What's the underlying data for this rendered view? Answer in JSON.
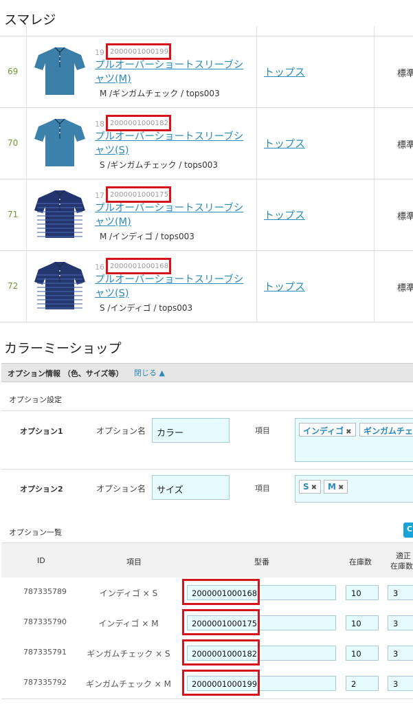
{
  "smaregi": {
    "title": "スマレジ",
    "rows": [
      {
        "num": "69",
        "rank": "19",
        "code": "2000001000199",
        "name": "プルオーバーショートスリーブシャツ(M)",
        "variant": "M  /ギンガムチェック  / tops003",
        "category": "トップス",
        "std": "標準",
        "shirt_color": "#3b7ea8",
        "stripe": false
      },
      {
        "num": "70",
        "rank": "18",
        "code": "2000001000182",
        "name": "プルオーバーショートスリーブシャツ(S)",
        "variant": "S  /ギンガムチェック  / tops003",
        "category": "トップス",
        "std": "標準",
        "shirt_color": "#3d82ad",
        "stripe": false
      },
      {
        "num": "71",
        "rank": "17",
        "code": "2000001000175",
        "name": "プルオーバーショートスリーブシャツ(M)",
        "variant": "M  /インディゴ  / tops003",
        "category": "トップス",
        "std": "標準",
        "shirt_color": "#23346e",
        "stripe": true
      },
      {
        "num": "72",
        "rank": "16",
        "code": "2000001000168",
        "name": "プルオーバーショートスリーブシャツ(S)",
        "variant": "S  /インディゴ  / tops003",
        "category": "トップス",
        "std": "標準",
        "shirt_color": "#24376f",
        "stripe": true
      }
    ]
  },
  "colorme": {
    "title": "カラーミーショップ",
    "option_bar": {
      "title": "オプション情報 （色、サイズ等）",
      "close": "閉じる ▲"
    },
    "settings_label": "オプション設定",
    "option1": {
      "label": "オプション1",
      "name_label": "オプション名",
      "name_value": "カラー",
      "item_label": "項目",
      "tags": [
        "インディゴ",
        "ギンガムチェ"
      ]
    },
    "option2": {
      "label": "オプション2",
      "name_label": "オプション名",
      "name_value": "サイズ",
      "item_label": "項目",
      "tags": [
        "S",
        "M"
      ]
    },
    "list_label": "オプション一覧",
    "list_button": "C",
    "headers": {
      "id": "ID",
      "item": "項目",
      "model": "型番",
      "stock": "在庫数",
      "proper_line1": "適正",
      "proper_line2": "在庫数"
    },
    "rows": [
      {
        "id": "787335789",
        "item": "インディゴ  ×  S",
        "model": "2000001000168",
        "stock": "10",
        "proper": "3"
      },
      {
        "id": "787335790",
        "item": "インディゴ  ×  M",
        "model": "2000001000175",
        "stock": "10",
        "proper": "3"
      },
      {
        "id": "787335791",
        "item": "ギンガムチェック  ×  S",
        "model": "2000001000182",
        "stock": "10",
        "proper": "3"
      },
      {
        "id": "787335792",
        "item": "ギンガムチェック  ×  M",
        "model": "2000001000199",
        "stock": "2",
        "proper": "3"
      }
    ]
  },
  "colors": {
    "link": "#2a8ab9",
    "highlight": "#d4141c",
    "input_bg": "#e6fbfd",
    "row_num": "#6a9b2e"
  }
}
